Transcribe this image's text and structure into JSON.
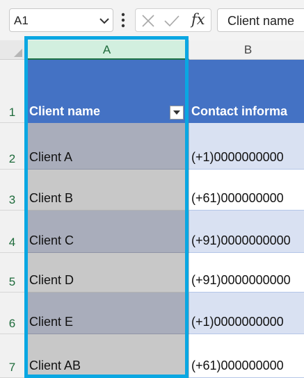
{
  "formula_bar": {
    "name_box": "A1",
    "fx_label": "fx",
    "formula_value": "Client name"
  },
  "columns": [
    {
      "label": "A",
      "selected": true
    },
    {
      "label": "B",
      "selected": false
    }
  ],
  "rows": [
    {
      "num": "1",
      "a": "Client name",
      "b": "Contact informa"
    },
    {
      "num": "2",
      "a": "Client A",
      "b": "(+1)0000000000"
    },
    {
      "num": "3",
      "a": "Client B",
      "b": "(+61)000000000"
    },
    {
      "num": "4",
      "a": "Client C",
      "b": "(+91)0000000000"
    },
    {
      "num": "5",
      "a": "Client D",
      "b": "(+91)0000000000"
    },
    {
      "num": "6",
      "a": "Client E",
      "b": "(+1)0000000000"
    },
    {
      "num": "7",
      "a": "Client AB",
      "b": "(+61)000000000"
    }
  ],
  "colors": {
    "header_fill": "#4472c4",
    "band_fill": "#d9e1f2",
    "selection_outline": "#0aa7e2",
    "selected_header": "#d2efdf"
  }
}
